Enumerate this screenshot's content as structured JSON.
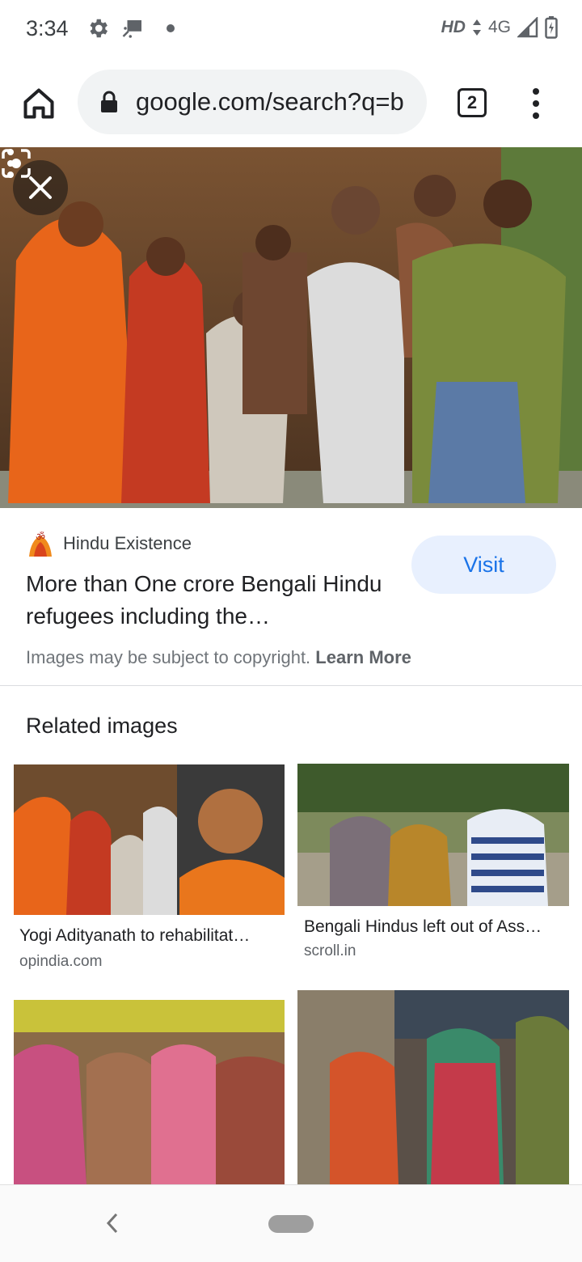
{
  "status_bar": {
    "time": "3:34",
    "icons": [
      "settings-icon",
      "cast-icon",
      "dot-icon"
    ],
    "hd": "HD",
    "network": "4G",
    "signal_icon": "signal-icon",
    "battery_icon": "battery-icon"
  },
  "toolbar": {
    "url": "google.com/search?q=b",
    "tab_count": "2"
  },
  "hero": {
    "close_icon": "close-icon",
    "lens_icon": "lens-icon",
    "menu_icon": "more-vert-icon"
  },
  "result": {
    "source_name": "Hindu Existence",
    "title": "More than One crore Bengali Hindu refugees including the…",
    "visit_label": "Visit",
    "copyright_text": "Images may be subject to copyright.",
    "learn_more": "Learn More"
  },
  "related": {
    "heading": "Related images",
    "items": [
      {
        "caption": "Yogi Adityanath to rehabilitat…",
        "site": "opindia.com"
      },
      {
        "caption": "Bengali Hindus left out of Ass…",
        "site": "scroll.in"
      },
      {
        "caption": "",
        "site": ""
      },
      {
        "caption": "",
        "site": ""
      }
    ]
  },
  "colors": {
    "accent": "#1a73e8",
    "visit_bg": "#e8f0fe",
    "url_bar_bg": "#f1f3f4"
  }
}
